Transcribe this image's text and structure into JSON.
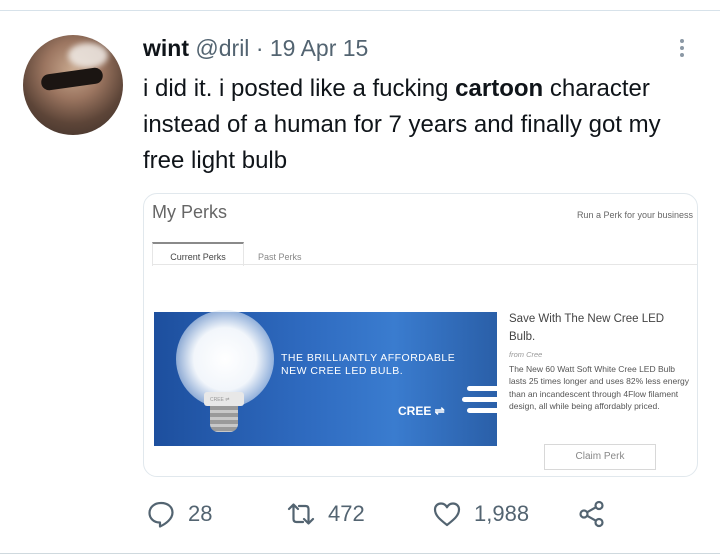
{
  "tweet": {
    "name": "wint",
    "handle": "@dril",
    "separator": "·",
    "date": "19 Apr 15",
    "text_before": "i did it. i posted like a fucking ",
    "text_bold": "cartoon",
    "text_after": " character instead of a human for 7 years and finally got my free light bulb"
  },
  "media": {
    "page_title": "My Perks",
    "run_perk_link": "Run a Perk for your business",
    "tabs": [
      "Current Perks",
      "Past Perks"
    ],
    "banner_text_line1": "THE BRILLIANTLY AFFORDABLE",
    "banner_text_line2": "NEW CREE LED BULB.",
    "banner_logo": "CREE ⇌",
    "bulb_label": "CREE ⇌",
    "perk_title": "Save With The New Cree LED Bulb.",
    "perk_from": "from Cree",
    "perk_description": "The New 60 Watt Soft White Cree LED Bulb lasts 25 times longer and uses 82% less energy than an incandescent through 4Flow filament design, all while being affordably priced.",
    "claim_button": "Claim Perk"
  },
  "actions": {
    "replies": "28",
    "retweets": "472",
    "likes": "1,988"
  },
  "icons": [
    "more-icon",
    "reply-icon",
    "retweet-icon",
    "like-icon",
    "share-icon"
  ],
  "colors": {
    "text": "#0f1419",
    "muted": "#536471",
    "banner_blue": "#2f6bc0"
  }
}
